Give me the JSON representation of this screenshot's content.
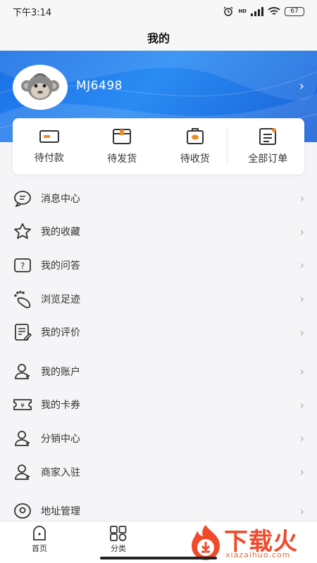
{
  "status": {
    "time": "下午3:14",
    "signal_tag": "HD",
    "battery": "67"
  },
  "page_title": "我的",
  "profile": {
    "username": "MJ6498"
  },
  "orders": [
    {
      "label": "待付款",
      "icon": "wallet-icon"
    },
    {
      "label": "待发货",
      "icon": "box-icon"
    },
    {
      "label": "待收货",
      "icon": "delivery-icon"
    },
    {
      "label": "全部订单",
      "icon": "order-list-icon"
    }
  ],
  "menu": [
    {
      "label": "消息中心",
      "icon": "message-icon"
    },
    {
      "label": "我的收藏",
      "icon": "star-icon"
    },
    {
      "label": "我的问答",
      "icon": "question-icon"
    },
    {
      "label": "浏览足迹",
      "icon": "footprint-icon"
    },
    {
      "label": "我的评价",
      "icon": "review-icon"
    },
    {
      "label": "我的账户",
      "icon": "account-icon"
    },
    {
      "label": "我的卡券",
      "icon": "coupon-icon"
    },
    {
      "label": "分销中心",
      "icon": "distribution-icon"
    },
    {
      "label": "商家入驻",
      "icon": "merchant-icon"
    },
    {
      "label": "地址管理",
      "icon": "location-icon"
    }
  ],
  "tabs": [
    {
      "label": "首页",
      "icon": "home-icon"
    },
    {
      "label": "分类",
      "icon": "category-icon"
    }
  ],
  "watermark": {
    "text": "下载火",
    "sub": "xiazaihuo.com"
  },
  "colors": {
    "header": "#1a6fe6",
    "accent_orange": "#f08a24",
    "watermark": "#f04a2a"
  }
}
